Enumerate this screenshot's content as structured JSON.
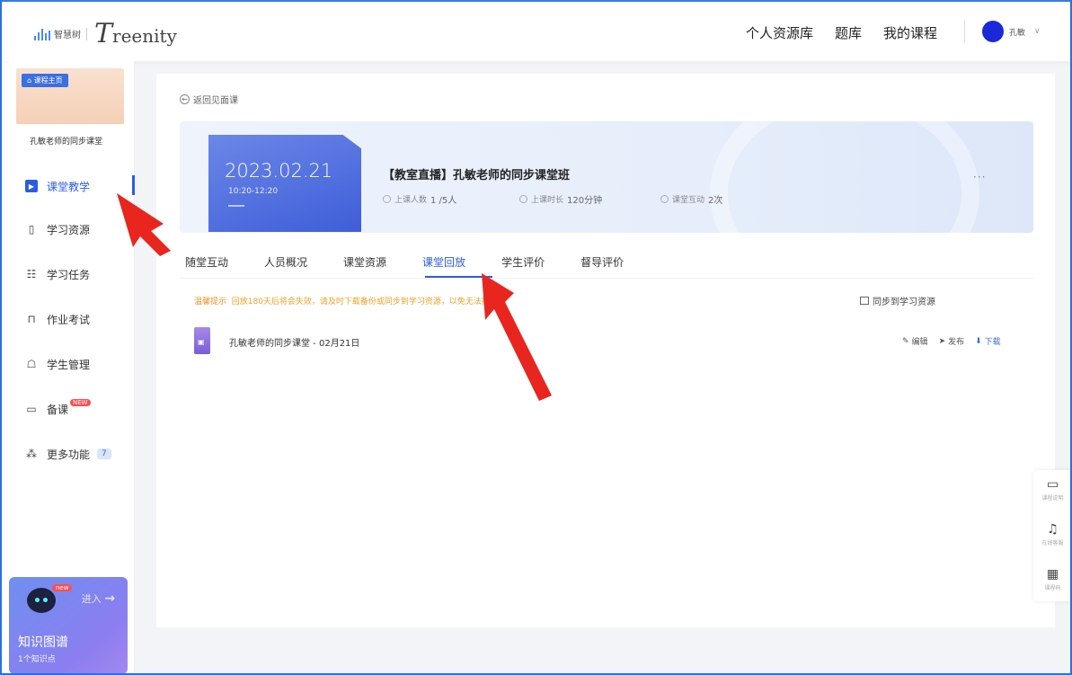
{
  "header": {
    "logo_cn": "智慧树",
    "logo_brand": "reenity",
    "logo_brand_initial": "T",
    "nav": [
      "个人资源库",
      "题库",
      "我的课程"
    ],
    "user_name": "孔敏",
    "user_caret": "∨"
  },
  "sidebar": {
    "course_home_tag": "课程主页",
    "course_title": "孔敏老师的同步课堂",
    "items": [
      {
        "label": "课堂教学",
        "icon": "classroom-teaching-icon"
      },
      {
        "label": "学习资源",
        "icon": "learning-resource-icon"
      },
      {
        "label": "学习任务",
        "icon": "learning-task-icon"
      },
      {
        "label": "作业考试",
        "icon": "homework-exam-icon"
      },
      {
        "label": "学生管理",
        "icon": "student-management-icon"
      },
      {
        "label": "备课",
        "icon": "lesson-prep-icon",
        "badge": "NEW"
      },
      {
        "label": "更多功能",
        "icon": "more-functions-icon",
        "count": "7"
      }
    ],
    "kg": {
      "badge": "new",
      "enter": "进入",
      "title": "知识图谱",
      "subtitle": "1个知识点"
    }
  },
  "main": {
    "back_label": "返回见面课",
    "banner": {
      "date": "2023.02.21",
      "time": "10:20-12:20",
      "title": "【教室直播】孔敏老师的同步课堂班",
      "attendance_label": "上课人数",
      "attendance_value": "1 /5人",
      "duration_label": "上课时长",
      "duration_value": "120分钟",
      "interaction_label": "课堂互动",
      "interaction_value": "2次",
      "more": "···"
    },
    "tabs": [
      "随堂互动",
      "人员概况",
      "课堂资源",
      "课堂回放",
      "学生评价",
      "督导评价"
    ],
    "active_tab": "课堂回放",
    "notice_prefix": "温馨提示",
    "notice_text": "回放180天后将会失效，请及时下载备份或同步到学习资源，以免无法找回",
    "sync_label": "同步到学习资源",
    "file": {
      "name": "孔敏老师的同步课堂 - 02月21日",
      "edit": "编辑",
      "publish": "发布",
      "download": "下载"
    }
  },
  "float_tools": [
    {
      "icon": "book-icon",
      "label": "课程说明"
    },
    {
      "icon": "headset-icon",
      "label": "在线客服"
    },
    {
      "icon": "qrcode-icon",
      "label": "课程码"
    }
  ],
  "colors": {
    "accent": "#2d5be3",
    "notice": "#f0a02a",
    "arrow": "#e8251f"
  }
}
